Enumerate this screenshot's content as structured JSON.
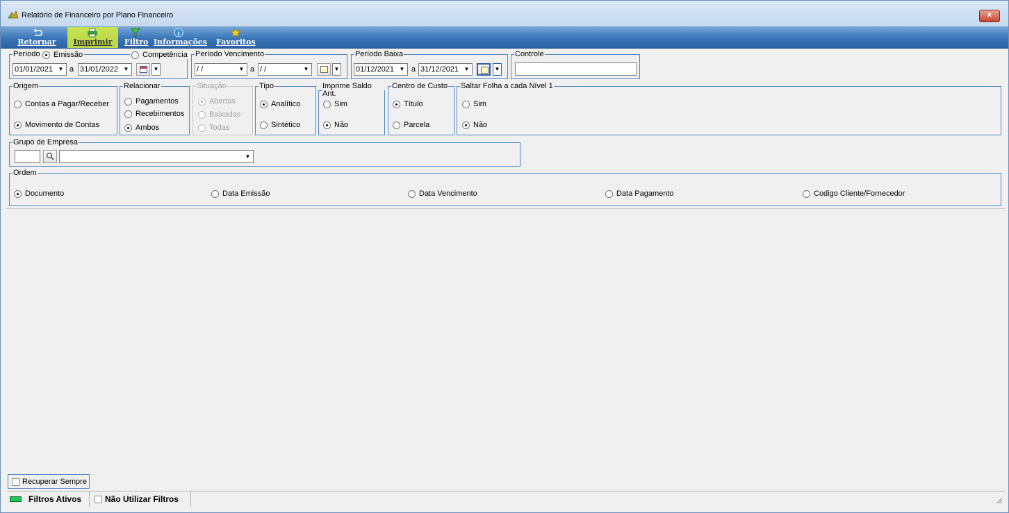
{
  "window": {
    "title": "Relatório de Financeiro por Plano Financeiro",
    "close_label": "×"
  },
  "toolbar": {
    "back_label": "Retornar",
    "print_label": "Imprimir",
    "filter_label": "Filtro",
    "info_label": "Informações",
    "favorites_label": "Favoritos"
  },
  "periodo": {
    "legend": "Período",
    "emissao_label": "Emissão",
    "competencia_label": "Competência",
    "from": "01/01/2021",
    "sep": "a",
    "to": "31/01/2022"
  },
  "vencimento": {
    "legend": "Período Vencimento",
    "from": " / /",
    "sep": "a",
    "to": " / /"
  },
  "baixa": {
    "legend": "Período Baixa",
    "from": "01/12/2021",
    "sep": "a",
    "to": "31/12/2021"
  },
  "controle": {
    "legend": "Controle",
    "value": ""
  },
  "origem": {
    "legend": "Origem",
    "options": [
      "Contas a Pagar/Receber",
      "Movimento de Contas"
    ]
  },
  "relacionar": {
    "legend": "Relacionar",
    "options": [
      "Pagamentos",
      "Recebimentos",
      "Ambos"
    ]
  },
  "situacao": {
    "legend": "Situação",
    "options": [
      "Abertas",
      "Baixadas",
      "Todas"
    ]
  },
  "tipo": {
    "legend": "Tipo",
    "options": [
      "Analítico",
      "Sintético"
    ]
  },
  "saldo": {
    "legend": "Imprime Saldo Ant.",
    "options": [
      "Sim",
      "Não"
    ]
  },
  "centro": {
    "legend": "Centro de Custo",
    "options": [
      "Título",
      "Parcela"
    ]
  },
  "saltar": {
    "legend": "Saltar Folha a cada Nível 1",
    "options": [
      "Sim",
      "Não"
    ]
  },
  "grupo": {
    "legend": "Grupo de Empresa",
    "code": "",
    "value": ""
  },
  "ordem": {
    "legend": "Ordem",
    "options": [
      "Documento",
      "Data Emissão",
      "Data Vencimento",
      "Data Pagamento",
      "Codigo Cliente/Fornecedor"
    ]
  },
  "recuperar_label": "Recuperar Sempre",
  "status": {
    "active_label": "Filtros Ativos",
    "no_filter_label": "Não Utilizar Filtros"
  },
  "colors": {
    "toolbar": "#3a76b8",
    "group_border": "#4f86c6",
    "highlight": "#d6ec3a"
  }
}
